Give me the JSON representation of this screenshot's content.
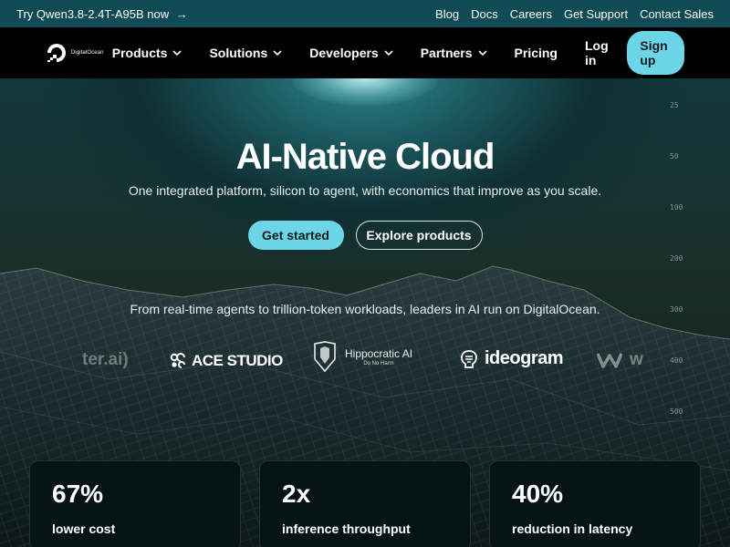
{
  "announcement": {
    "text": "Try Qwen3.8-2.4T-A95B now",
    "arrow": "→"
  },
  "top_links": [
    "Blog",
    "Docs",
    "Careers",
    "Get Support",
    "Contact Sales"
  ],
  "nav": {
    "brand": "DigitalOcean",
    "menu": [
      "Products",
      "Solutions",
      "Developers",
      "Partners",
      "Pricing"
    ],
    "login": "Log in",
    "signup": "Sign up"
  },
  "hero": {
    "title": "AI-Native Cloud",
    "subtitle": "One integrated platform, silicon to agent, with economics that improve as you scale.",
    "primary_cta": "Get started",
    "secondary_cta": "Explore products",
    "leaders_text": "From real-time agents to trillion-token workloads, leaders in AI run on DigitalOcean."
  },
  "brands": {
    "character": "ter.ai)",
    "ace": "ACE STUDIO",
    "hippocratic_name": "Hippocratic AI",
    "hippocratic_tag": "Do No Harm",
    "ideogram": "ideogram",
    "w": "w"
  },
  "ruler_ticks": [
    "25",
    "50",
    "100",
    "200",
    "300",
    "400",
    "500"
  ],
  "stats": [
    {
      "value": "67%",
      "label": "lower cost"
    },
    {
      "value": "2x",
      "label": "inference throughput"
    },
    {
      "value": "40%",
      "label": "reduction in latency"
    }
  ],
  "colors": {
    "accent": "#6cd5e8",
    "announcement_bg": "#0f4a55",
    "nav_bg": "#000000"
  }
}
